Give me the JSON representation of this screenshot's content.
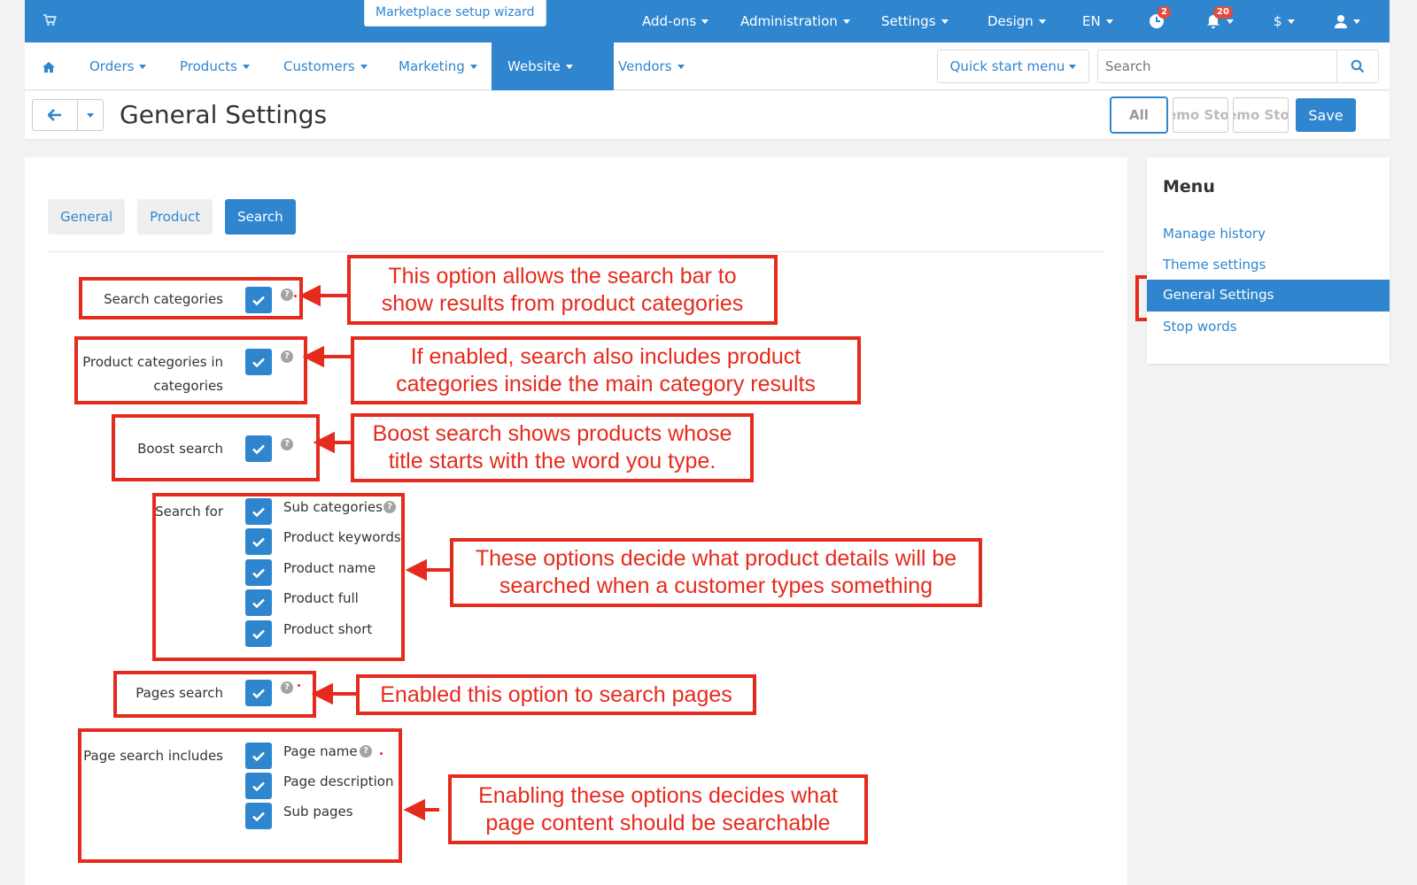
{
  "topbar": {
    "cart_icon": "cart-icon",
    "wizard_label": "Marketplace setup wizard",
    "menus": [
      "Add-ons",
      "Administration",
      "Settings",
      "Design",
      "EN"
    ],
    "orders_badge": "2",
    "notifications_badge": "20",
    "currency": "$"
  },
  "navbar": {
    "items": [
      "Orders",
      "Products",
      "Customers",
      "Marketing",
      "Website",
      "Vendors"
    ],
    "active": "Website",
    "quick_start": "Quick start menu",
    "search_placeholder": "Search"
  },
  "titlebar": {
    "title": "General Settings",
    "store_all": "All",
    "store_1": "Demo Store",
    "store_2": "Demo Store",
    "save": "Save"
  },
  "tabs": [
    "General",
    "Product",
    "Search"
  ],
  "settings": {
    "search_categories": "Search categories",
    "product_categories_line1": "Product categories in",
    "product_categories_line2": "categories",
    "boost_search": "Boost search",
    "search_for": "Search for",
    "search_for_options": [
      "Sub categories",
      "Product keywords",
      "Product name",
      "Product full",
      "Product short"
    ],
    "pages_search": "Pages search",
    "page_search_includes": "Page search includes",
    "page_search_options": [
      "Page name",
      "Page description",
      "Sub pages"
    ]
  },
  "callouts": {
    "c1": [
      "This option allows the search bar to",
      "show results from product categories"
    ],
    "c2": [
      "If enabled, search also includes product",
      "categories inside the main category results"
    ],
    "c3": [
      "Boost search shows products whose",
      "title starts with the word you type."
    ],
    "c4": [
      "These options decide what product details will be",
      "searched when a customer types something"
    ],
    "c5": [
      "Enabled this option to search pages"
    ],
    "c6": [
      "Enabling these options decides what",
      "page content should be searchable"
    ]
  },
  "sidebar": {
    "title": "Menu",
    "links": [
      "Manage history",
      "Theme settings",
      "General Settings",
      "Stop words"
    ],
    "active": "General Settings"
  },
  "colors": {
    "primary": "#2f86cf",
    "annotation_red": "#e52b1d"
  }
}
